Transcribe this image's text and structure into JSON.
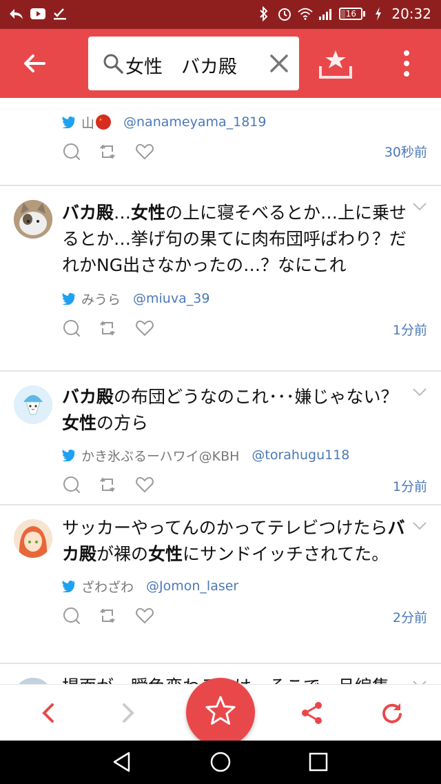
{
  "status_bar": {
    "time": "20:32",
    "battery": "16"
  },
  "app_bar": {
    "search_query": "女性　バカ殿"
  },
  "tweets": [
    {
      "text_html": "",
      "author_name": "山",
      "author_handle": "@nanameyama_1819",
      "time": "30秒前"
    },
    {
      "text_html": "<b>バカ殿</b>…<b>女性</b>の上に寝そべるとか…上に乗せるとか…挙げ句の果てに肉布団呼ばわり？だれかNG出さなかったの…？なにこれ",
      "author_name": "みうら",
      "author_handle": "@miuva_39",
      "time": "1分前"
    },
    {
      "text_html": "<b>バカ殿</b>の布団どうなのこれ･･･嫌じゃない？<b>女性</b>の方ら",
      "author_name": "かき氷ぶるーハワイ@KBH",
      "author_handle": "@torahugu118",
      "time": "1分前"
    },
    {
      "text_html": "サッカーやってんのかってテレビつけたら<b>バカ殿</b>が裸の<b>女性</b>にサンドイッチされてた。",
      "author_name": "ざわざわ",
      "author_handle": "@Jomon_laser",
      "time": "2分前"
    },
    {
      "text_html": "場面が一瞬色変わるのは、そこで一旦編集",
      "author_name": "",
      "author_handle": "",
      "time": ""
    }
  ],
  "icons": {
    "back": "back-arrow-icon",
    "search": "search-icon",
    "clear": "close-icon",
    "save": "save-search-icon",
    "more": "more-vert-icon",
    "reply": "reply-icon",
    "retweet": "retweet-icon",
    "like": "heart-icon"
  },
  "colors": {
    "accent": "#e9484b",
    "status_bar": "#8f1f1f",
    "link": "#4b78b8"
  }
}
